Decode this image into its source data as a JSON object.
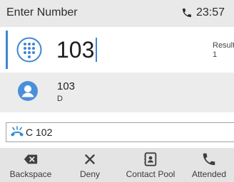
{
  "header": {
    "title": "Enter Number",
    "time": "23:57",
    "icon": "phone-icon"
  },
  "entry": {
    "number": "103",
    "icon": "dialpad-icon",
    "results_label": "Result",
    "results_count": "1"
  },
  "result_item": {
    "name": "103",
    "detail": "D",
    "icon": "contact-avatar-icon"
  },
  "active_call": {
    "label": "C 102",
    "icon": "call-hold-icon"
  },
  "softkeys": [
    {
      "label": "Backspace",
      "icon": "backspace-icon"
    },
    {
      "label": "Deny",
      "icon": "close-icon"
    },
    {
      "label": "Contact Pool",
      "icon": "contact-book-icon"
    },
    {
      "label": "Attended",
      "icon": "phone-icon"
    }
  ],
  "colors": {
    "accent": "#3d86d2",
    "header_bg": "#e9e9e9",
    "result_bg": "#ececec",
    "softkey_bg": "#e4e4e4"
  }
}
